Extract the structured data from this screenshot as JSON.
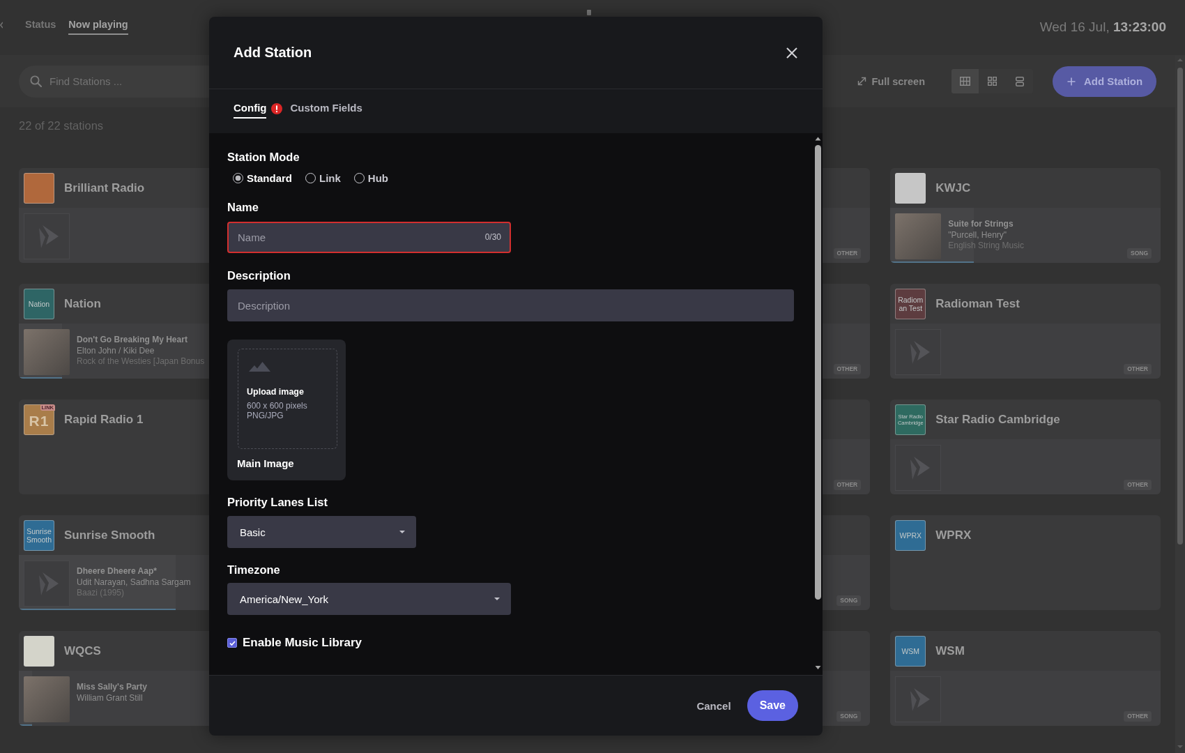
{
  "top_bar": {
    "tabs": [
      {
        "label": "Status",
        "selected": false
      },
      {
        "label": "Now playing",
        "selected": true
      }
    ],
    "datetime": "Wed 16 Jul, **13:23:00**"
  },
  "toolbar": {
    "search": {
      "placeholder": "Find Stations ..."
    },
    "full_screen": "Full screen",
    "view_modes": [
      {
        "kind": "table",
        "selected": true
      },
      {
        "kind": "tiles",
        "selected": false
      },
      {
        "kind": "rows",
        "selected": false
      }
    ],
    "add_button": "Add Station"
  },
  "station_count": "22 of 22 stations",
  "stations": {
    "column_1": [
      {
        "name": "Brilliant Radio",
        "logo": {
          "kind": "image",
          "color": "#b0683c"
        },
        "now_playing": {
          "kind": "idle"
        }
      },
      {
        "name": "Nation",
        "logo": {
          "kind": "text",
          "text": "Nation",
          "color": "#2e6565"
        },
        "now_playing": {
          "kind": "song",
          "artwork": {
            "kind": "photo"
          },
          "title": "Don't Go Breaking My Heart",
          "artist": "Elton John / Kiki Dee",
          "album": "Rock of the Westies [Japan Bonus",
          "level": 0.16
        }
      },
      {
        "name": "Rapid Radio 1",
        "logo": {
          "kind": "monogram",
          "text": "R1",
          "color": "#a97d4a",
          "badge": "LINK"
        },
        "now_playing": {
          "kind": "empty"
        }
      },
      {
        "name": "Sunrise Smooth",
        "logo": {
          "kind": "text",
          "text": "Sunrise Smooth",
          "color": "#2f6c94"
        },
        "now_playing": {
          "kind": "song",
          "artwork": {
            "kind": "placeholder"
          },
          "title": "Dheere Dheere Aap*",
          "artist": "Udit Narayan, Sadhna Sargam",
          "album": "Baazi (1995)",
          "level": 0.58
        }
      },
      {
        "name": "WQCS",
        "logo": {
          "kind": "image",
          "color": "#d4d4ca"
        },
        "now_playing": {
          "kind": "song",
          "artwork": {
            "kind": "photo"
          },
          "title": "Miss Sally's Party",
          "artist": "William Grant Still",
          "level": 0.05
        }
      }
    ],
    "column_3": [
      {
        "tag": "OTHER"
      },
      {
        "tag": "OTHER"
      },
      {
        "tag": "OTHER"
      },
      {
        "tag": "SONG"
      },
      {
        "tag": "SONG"
      }
    ],
    "column_4": [
      {
        "name": "KWJC",
        "logo": {
          "kind": "image",
          "color": "#c6c6c6"
        },
        "now_playing": {
          "kind": "song",
          "artwork": {
            "kind": "photo"
          },
          "title": "Suite for Strings",
          "artist": "\"Purcell, Henry\"",
          "album": "English String Music",
          "level": 0.31
        },
        "tag": "SONG"
      },
      {
        "name": "Radioman Test",
        "logo": {
          "kind": "text",
          "text": "Radioman Test",
          "color": "#5d3c3f"
        },
        "now_playing": {
          "kind": "idle"
        },
        "tag": "OTHER"
      },
      {
        "name": "Star Radio Cambridge",
        "logo": {
          "kind": "fine",
          "text": "Star Radio Cambridge",
          "color": "#2e6a60"
        },
        "now_playing": {
          "kind": "idle"
        },
        "tag": "OTHER"
      },
      {
        "name": "WPRX",
        "logo": {
          "kind": "text",
          "text": "WPRX",
          "color": "#2f6c94"
        },
        "now_playing": {
          "kind": "empty"
        }
      },
      {
        "name": "WSM",
        "logo": {
          "kind": "text",
          "text": "WSM",
          "color": "#2f6c94"
        },
        "now_playing": {
          "kind": "idle"
        },
        "tag": "OTHER"
      }
    ]
  },
  "dialog": {
    "title": "Add Station",
    "tabs": [
      {
        "label": "Config",
        "selected": true,
        "error": true
      },
      {
        "label": "Custom Fields",
        "selected": false,
        "error": false
      }
    ],
    "station_mode": {
      "label": "Station Mode",
      "options": [
        {
          "label": "Standard",
          "selected": true
        },
        {
          "label": "Link",
          "selected": false
        },
        {
          "label": "Hub",
          "selected": false
        }
      ]
    },
    "name": {
      "label": "Name",
      "placeholder": "Name",
      "counter": "0/30",
      "error": true
    },
    "description": {
      "label": "Description",
      "placeholder": "Description"
    },
    "main_image": {
      "title": "Upload image",
      "size": "600 x 600 pixels",
      "formats": "PNG/JPG",
      "label": "Main Image"
    },
    "priority_lanes": {
      "label": "Priority Lanes List",
      "value": "Basic"
    },
    "timezone": {
      "label": "Timezone",
      "value": "America/New_York"
    },
    "checkboxes": [
      {
        "label": "Enable Music Library",
        "checked": true
      }
    ],
    "buttons": {
      "cancel": "Cancel",
      "save": "Save"
    }
  }
}
